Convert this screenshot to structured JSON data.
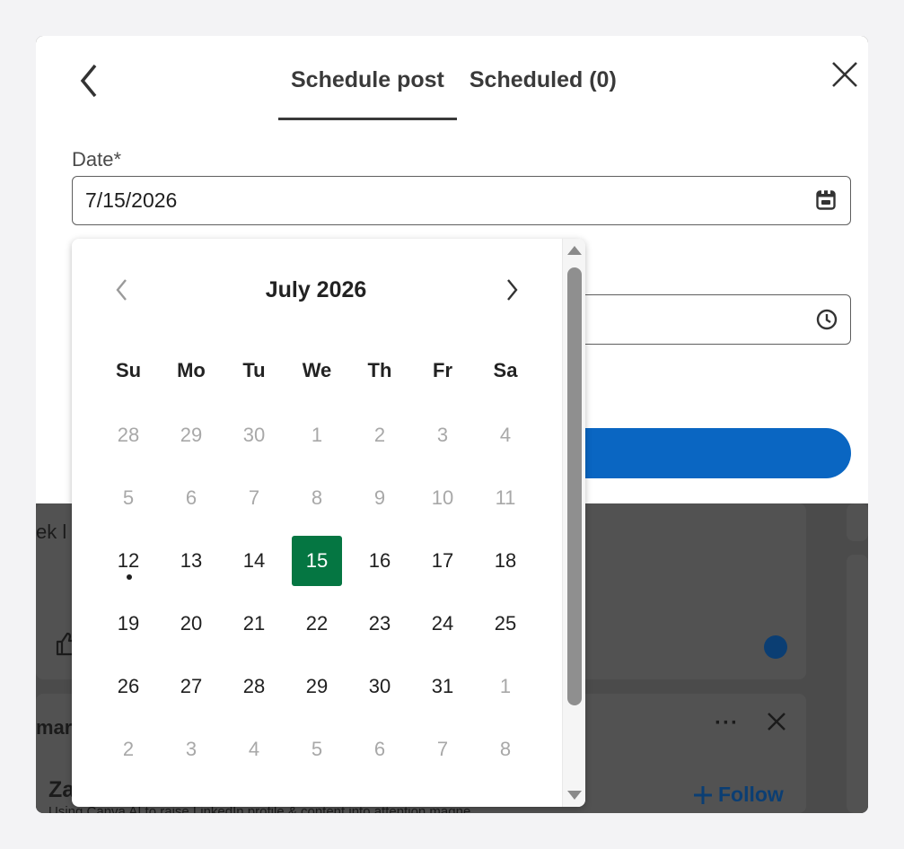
{
  "background": {
    "snippet_left": "ek l",
    "snippet_card_title": "mar",
    "snippet_name": "Za",
    "snippet_sub": "Using Canva AI to raise LinkedIn profile & content into attention magne",
    "follow_label": "Follow",
    "more_label": "···"
  },
  "modal": {
    "tabs": [
      {
        "label": "Schedule post",
        "active": true
      },
      {
        "label": "Scheduled (0)",
        "active": false
      }
    ],
    "date_label": "Date*",
    "date_value": "7/15/2026"
  },
  "calendar": {
    "month_title": "July 2026",
    "weekdays": [
      "Su",
      "Mo",
      "Tu",
      "We",
      "Th",
      "Fr",
      "Sa"
    ],
    "selected_day": "15",
    "today_day": "12",
    "weeks": [
      [
        {
          "d": "28",
          "m": true
        },
        {
          "d": "29",
          "m": true
        },
        {
          "d": "30",
          "m": true
        },
        {
          "d": "1",
          "m": true
        },
        {
          "d": "2",
          "m": true
        },
        {
          "d": "3",
          "m": true
        },
        {
          "d": "4",
          "m": true
        }
      ],
      [
        {
          "d": "5",
          "m": true
        },
        {
          "d": "6",
          "m": true
        },
        {
          "d": "7",
          "m": true
        },
        {
          "d": "8",
          "m": true
        },
        {
          "d": "9",
          "m": true
        },
        {
          "d": "10",
          "m": true
        },
        {
          "d": "11",
          "m": true
        }
      ],
      [
        {
          "d": "12",
          "m": false
        },
        {
          "d": "13",
          "m": false
        },
        {
          "d": "14",
          "m": false
        },
        {
          "d": "15",
          "m": false
        },
        {
          "d": "16",
          "m": false
        },
        {
          "d": "17",
          "m": false
        },
        {
          "d": "18",
          "m": false
        }
      ],
      [
        {
          "d": "19",
          "m": false
        },
        {
          "d": "20",
          "m": false
        },
        {
          "d": "21",
          "m": false
        },
        {
          "d": "22",
          "m": false
        },
        {
          "d": "23",
          "m": false
        },
        {
          "d": "24",
          "m": false
        },
        {
          "d": "25",
          "m": false
        }
      ],
      [
        {
          "d": "26",
          "m": false
        },
        {
          "d": "27",
          "m": false
        },
        {
          "d": "28",
          "m": false
        },
        {
          "d": "29",
          "m": false
        },
        {
          "d": "30",
          "m": false
        },
        {
          "d": "31",
          "m": false
        },
        {
          "d": "1",
          "m": true
        }
      ],
      [
        {
          "d": "2",
          "m": true
        },
        {
          "d": "3",
          "m": true
        },
        {
          "d": "4",
          "m": true
        },
        {
          "d": "5",
          "m": true
        },
        {
          "d": "6",
          "m": true
        },
        {
          "d": "7",
          "m": true
        },
        {
          "d": "8",
          "m": true
        }
      ]
    ]
  },
  "colors": {
    "selected": "#057642",
    "primary_button": "#0a66c2",
    "muted_text": "#a8a8a8"
  }
}
